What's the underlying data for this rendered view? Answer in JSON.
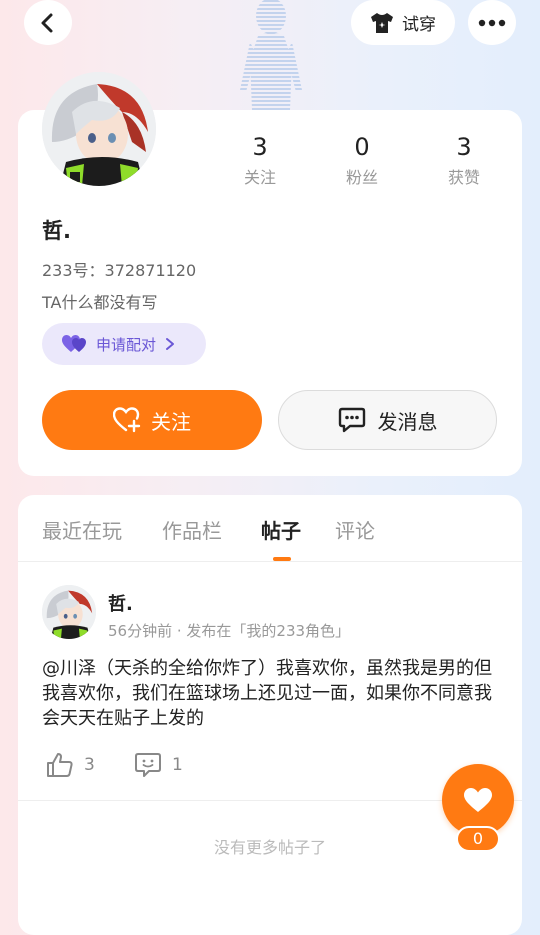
{
  "header": {
    "try_on_label": "试穿"
  },
  "profile": {
    "name": "哲.",
    "id_label": "233号：",
    "id_value": "372871120",
    "bio": "TA什么都没有写",
    "pair_label": "申请配对",
    "follow_label": "关注",
    "message_label": "发消息",
    "stats": [
      {
        "value": "3",
        "label": "关注"
      },
      {
        "value": "0",
        "label": "粉丝"
      },
      {
        "value": "3",
        "label": "获赞"
      }
    ]
  },
  "tabs": [
    {
      "label": "最近在玩"
    },
    {
      "label": "作品栏"
    },
    {
      "label": "帖子"
    },
    {
      "label": "评论"
    }
  ],
  "active_tab": "帖子",
  "post": {
    "author": "哲.",
    "time": "56分钟前",
    "published_in": "· 发布在「我的233角色」",
    "body": "@川泽（天杀的全给你炸了）我喜欢你，虽然我是男的但我喜欢你，我们在篮球场上还见过一面，如果你不同意我会天天在贴子上发的",
    "likes": "3",
    "comments": "1"
  },
  "footer": {
    "no_more": "没有更多帖子了",
    "fab_count": "0"
  },
  "colors": {
    "accent": "#ff7a12",
    "pair_purple": "#6a57d6"
  }
}
